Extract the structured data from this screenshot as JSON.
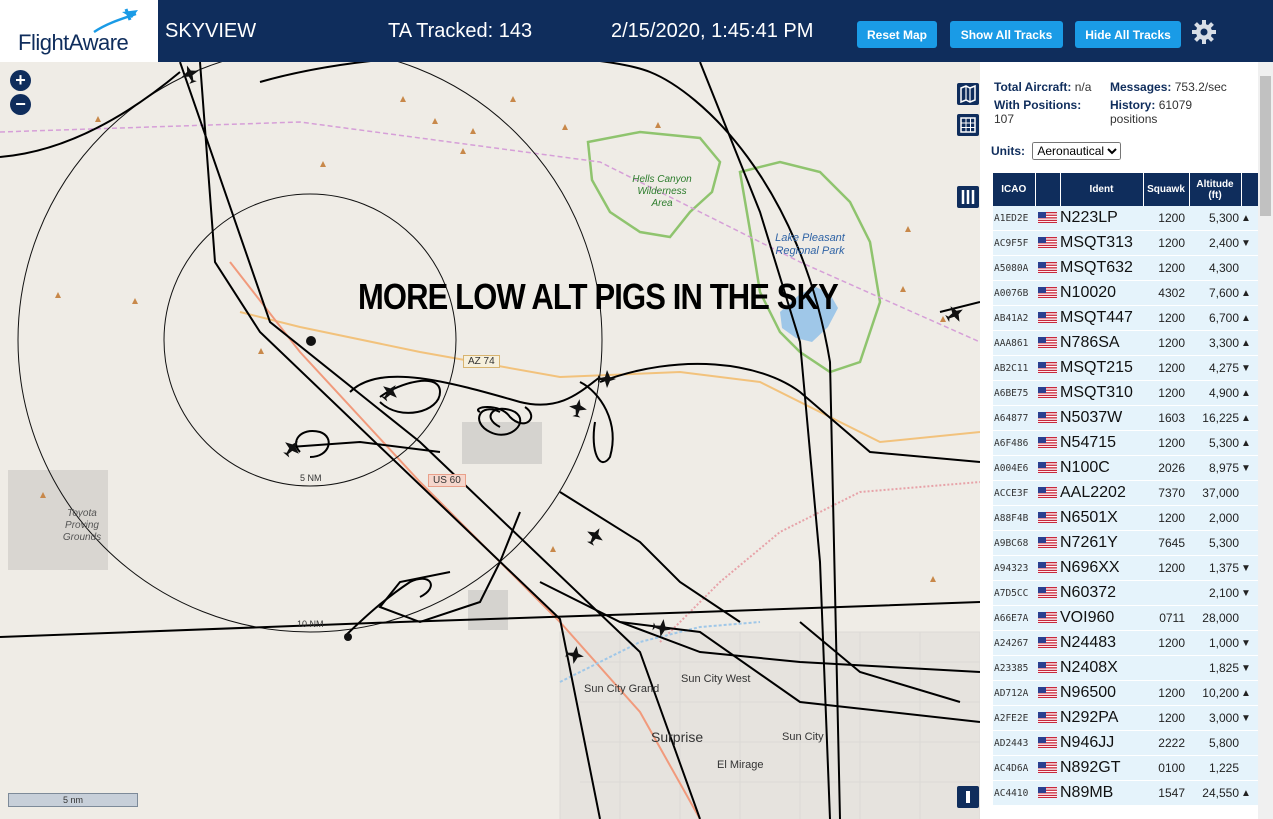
{
  "header": {
    "logo_text": "FlightAware",
    "app_title": "SKYVIEW",
    "ta_tracked": "TA Tracked: 143",
    "timestamp": "2/15/2020, 1:45:41 PM",
    "buttons": {
      "reset": "Reset Map",
      "show_all": "Show All Tracks",
      "hide_all": "Hide All Tracks"
    }
  },
  "map": {
    "zoom_in": "+",
    "zoom_out": "−",
    "overlay_message": "MORE LOW ALT PIGS IN THE SKY",
    "ring_labels": [
      "5 NM",
      "10 NM"
    ],
    "park_labels": {
      "hells_canyon": "Hells Canyon Wilderness Area",
      "toyota": "Toyota Proving Grounds"
    },
    "lake_label": "Lake Pleasant Regional Park",
    "roads": {
      "az74": "AZ 74",
      "us60": "US 60"
    },
    "cities": {
      "sun_city_grand": "Sun City Grand",
      "sun_city_west": "Sun City West",
      "surprise": "Surprise",
      "sun_city": "Sun City",
      "el_mirage": "El Mirage"
    },
    "scale_label": "5 nm"
  },
  "panel": {
    "total_aircraft_label": "Total Aircraft:",
    "total_aircraft_value": "n/a",
    "with_positions_label": "With Positions:",
    "with_positions_value": "107",
    "messages_label": "Messages:",
    "messages_value": "753.2/sec",
    "history_label": "History:",
    "history_value": "61079 positions",
    "units_label": "Units:",
    "units_selected": "Aeronautical",
    "columns": {
      "icao": "ICAO",
      "flag": "",
      "ident": "Ident",
      "squawk": "Squawk",
      "altitude": "Altitude (ft)"
    },
    "rows": [
      {
        "icao": "A1ED2E",
        "ident": "N223LP",
        "squawk": "1200",
        "alt": "5,300",
        "trend": "▲"
      },
      {
        "icao": "AC9F5F",
        "ident": "MSQT313",
        "squawk": "1200",
        "alt": "2,400",
        "trend": "▼"
      },
      {
        "icao": "A5080A",
        "ident": "MSQT632",
        "squawk": "1200",
        "alt": "4,300",
        "trend": ""
      },
      {
        "icao": "A0076B",
        "ident": "N10020",
        "squawk": "4302",
        "alt": "7,600",
        "trend": "▲"
      },
      {
        "icao": "AB41A2",
        "ident": "MSQT447",
        "squawk": "1200",
        "alt": "6,700",
        "trend": "▲"
      },
      {
        "icao": "AAA861",
        "ident": "N786SA",
        "squawk": "1200",
        "alt": "3,300",
        "trend": "▲"
      },
      {
        "icao": "AB2C11",
        "ident": "MSQT215",
        "squawk": "1200",
        "alt": "4,275",
        "trend": "▼"
      },
      {
        "icao": "A6BE75",
        "ident": "MSQT310",
        "squawk": "1200",
        "alt": "4,900",
        "trend": "▲"
      },
      {
        "icao": "A64877",
        "ident": "N5037W",
        "squawk": "1603",
        "alt": "16,225",
        "trend": "▲"
      },
      {
        "icao": "A6F486",
        "ident": "N54715",
        "squawk": "1200",
        "alt": "5,300",
        "trend": "▲"
      },
      {
        "icao": "A004E6",
        "ident": "N100C",
        "squawk": "2026",
        "alt": "8,975",
        "trend": "▼"
      },
      {
        "icao": "ACCE3F",
        "ident": "AAL2202",
        "squawk": "7370",
        "alt": "37,000",
        "trend": ""
      },
      {
        "icao": "A88F4B",
        "ident": "N6501X",
        "squawk": "1200",
        "alt": "2,000",
        "trend": ""
      },
      {
        "icao": "A9BC68",
        "ident": "N7261Y",
        "squawk": "7645",
        "alt": "5,300",
        "trend": ""
      },
      {
        "icao": "A94323",
        "ident": "N696XX",
        "squawk": "1200",
        "alt": "1,375",
        "trend": "▼"
      },
      {
        "icao": "A7D5CC",
        "ident": "N60372",
        "squawk": "",
        "alt": "2,100",
        "trend": "▼"
      },
      {
        "icao": "A66E7A",
        "ident": "VOI960",
        "squawk": "0711",
        "alt": "28,000",
        "trend": ""
      },
      {
        "icao": "A24267",
        "ident": "N24483",
        "squawk": "1200",
        "alt": "1,000",
        "trend": "▼"
      },
      {
        "icao": "A23385",
        "ident": "N2408X",
        "squawk": "",
        "alt": "1,825",
        "trend": "▼"
      },
      {
        "icao": "AD712A",
        "ident": "N96500",
        "squawk": "1200",
        "alt": "10,200",
        "trend": "▲"
      },
      {
        "icao": "A2FE2E",
        "ident": "N292PA",
        "squawk": "1200",
        "alt": "3,000",
        "trend": "▼"
      },
      {
        "icao": "AD2443",
        "ident": "N946JJ",
        "squawk": "2222",
        "alt": "5,800",
        "trend": ""
      },
      {
        "icao": "AC4D6A",
        "ident": "N892GT",
        "squawk": "0100",
        "alt": "1,225",
        "trend": ""
      },
      {
        "icao": "AC4410",
        "ident": "N89MB",
        "squawk": "1547",
        "alt": "24,550",
        "trend": "▲"
      }
    ]
  },
  "colors": {
    "header_bg": "#0f2d5c",
    "button_bg": "#1a9be6",
    "row_bg": "#e5f3fb",
    "track": "#000000",
    "park": "#8fc46e",
    "lake": "#9fc7e8"
  },
  "icons": {
    "gear": "gear-icon",
    "map_layers": "map-layers-icon",
    "grid": "grid-icon",
    "columns": "columns-icon",
    "aircraft": "aircraft-icon"
  }
}
